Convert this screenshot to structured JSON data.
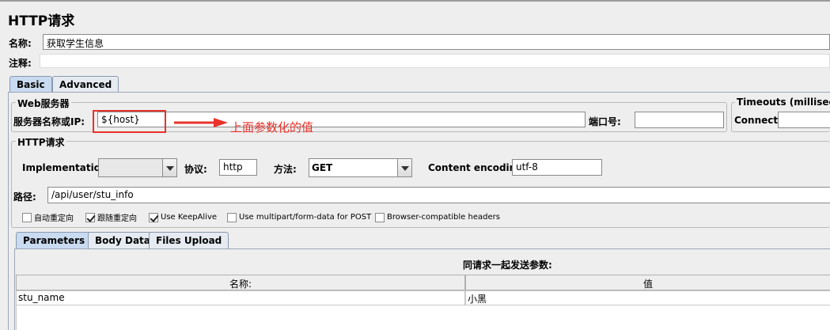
{
  "window": {
    "title": "HTTP请求"
  },
  "name_field": {
    "label": "名称:",
    "value": "获取学生信息"
  },
  "comment_field": {
    "label": "注释:",
    "value": ""
  },
  "tabs": [
    {
      "label": "Basic"
    },
    {
      "label": "Advanced"
    }
  ],
  "web_server": {
    "group_title": "Web服务器",
    "server_label": "服务器名称或IP:",
    "server_value": "${host}",
    "annotation": "上面参数化的值",
    "port_label": "端口号:",
    "port_value": ""
  },
  "timeouts": {
    "group_title": "Timeouts (millisecon",
    "connect_label": "Connect:",
    "connect_value": ""
  },
  "http_request": {
    "group_title": "HTTP请求",
    "implementation_label": "Implementation:",
    "implementation_value": "",
    "protocol_label": "协议:",
    "protocol_value": "http",
    "method_label": "方法:",
    "method_value": "GET",
    "encoding_label": "Content encoding:",
    "encoding_value": "utf-8",
    "path_label": "路径:",
    "path_value": "/api/user/stu_info"
  },
  "checkboxes": [
    {
      "label": "自动重定向",
      "checked": false
    },
    {
      "label": "跟随重定向",
      "checked": true
    },
    {
      "label": "Use KeepAlive",
      "checked": true
    },
    {
      "label": "Use multipart/form-data for POST",
      "checked": false
    },
    {
      "label": "Browser-compatible headers",
      "checked": false
    }
  ],
  "sub_tabs": [
    {
      "label": "Parameters"
    },
    {
      "label": "Body Data"
    },
    {
      "label": "Files Upload"
    }
  ],
  "params": {
    "caption": "同请求一起发送参数:",
    "columns": [
      "名称:",
      "值"
    ],
    "rows": [
      {
        "name": "stu_name",
        "value": "小黑"
      }
    ]
  },
  "colors": {
    "annotation_red": "#e8322b",
    "tab_active": "#c9dbf0"
  }
}
